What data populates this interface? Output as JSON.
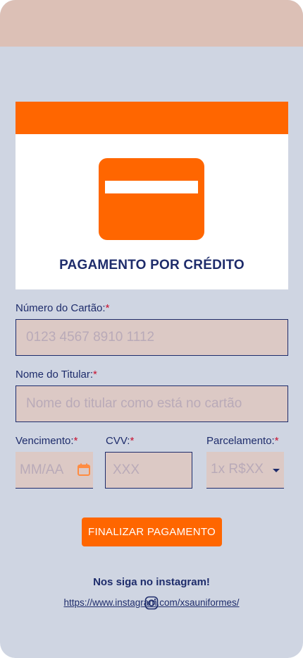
{
  "header": {
    "title": "PAGAMENTO POR CRÉDITO"
  },
  "card_icon": {
    "icon": "credit-card-icon"
  },
  "form": {
    "card_number": {
      "label": "Número do Cartão:",
      "required_mark": "*",
      "placeholder": "0123 4567 8910 1112",
      "value": ""
    },
    "holder_name": {
      "label": "Nome do Titular:",
      "required_mark": "*",
      "placeholder": "Nome do titular como está no cartão",
      "value": ""
    },
    "expiry": {
      "label": "Vencimento:",
      "required_mark": "*",
      "placeholder": "MM/AA",
      "icon": "calendar-icon",
      "value": ""
    },
    "cvv": {
      "label": "CVV:",
      "required_mark": "*",
      "placeholder": "XXX",
      "value": ""
    },
    "installments": {
      "label": "Parcelamento:",
      "required_mark": "*",
      "selected": "1x R$XX",
      "icon": "caret-down-icon"
    }
  },
  "actions": {
    "submit_label": "FINALIZAR PAGAMENTO"
  },
  "footer": {
    "follow_text": "Nos siga no instagram!",
    "instagram_url": "https://www.instagram.com/xsauniformes/",
    "icon": "instagram-icon"
  },
  "colors": {
    "accent": "#ff6600",
    "text": "#1e2c6b",
    "required": "#c8102e",
    "background": "#cfd5e2",
    "header_band": "#dcc0b6",
    "field_bg": "#dcc9c5"
  }
}
